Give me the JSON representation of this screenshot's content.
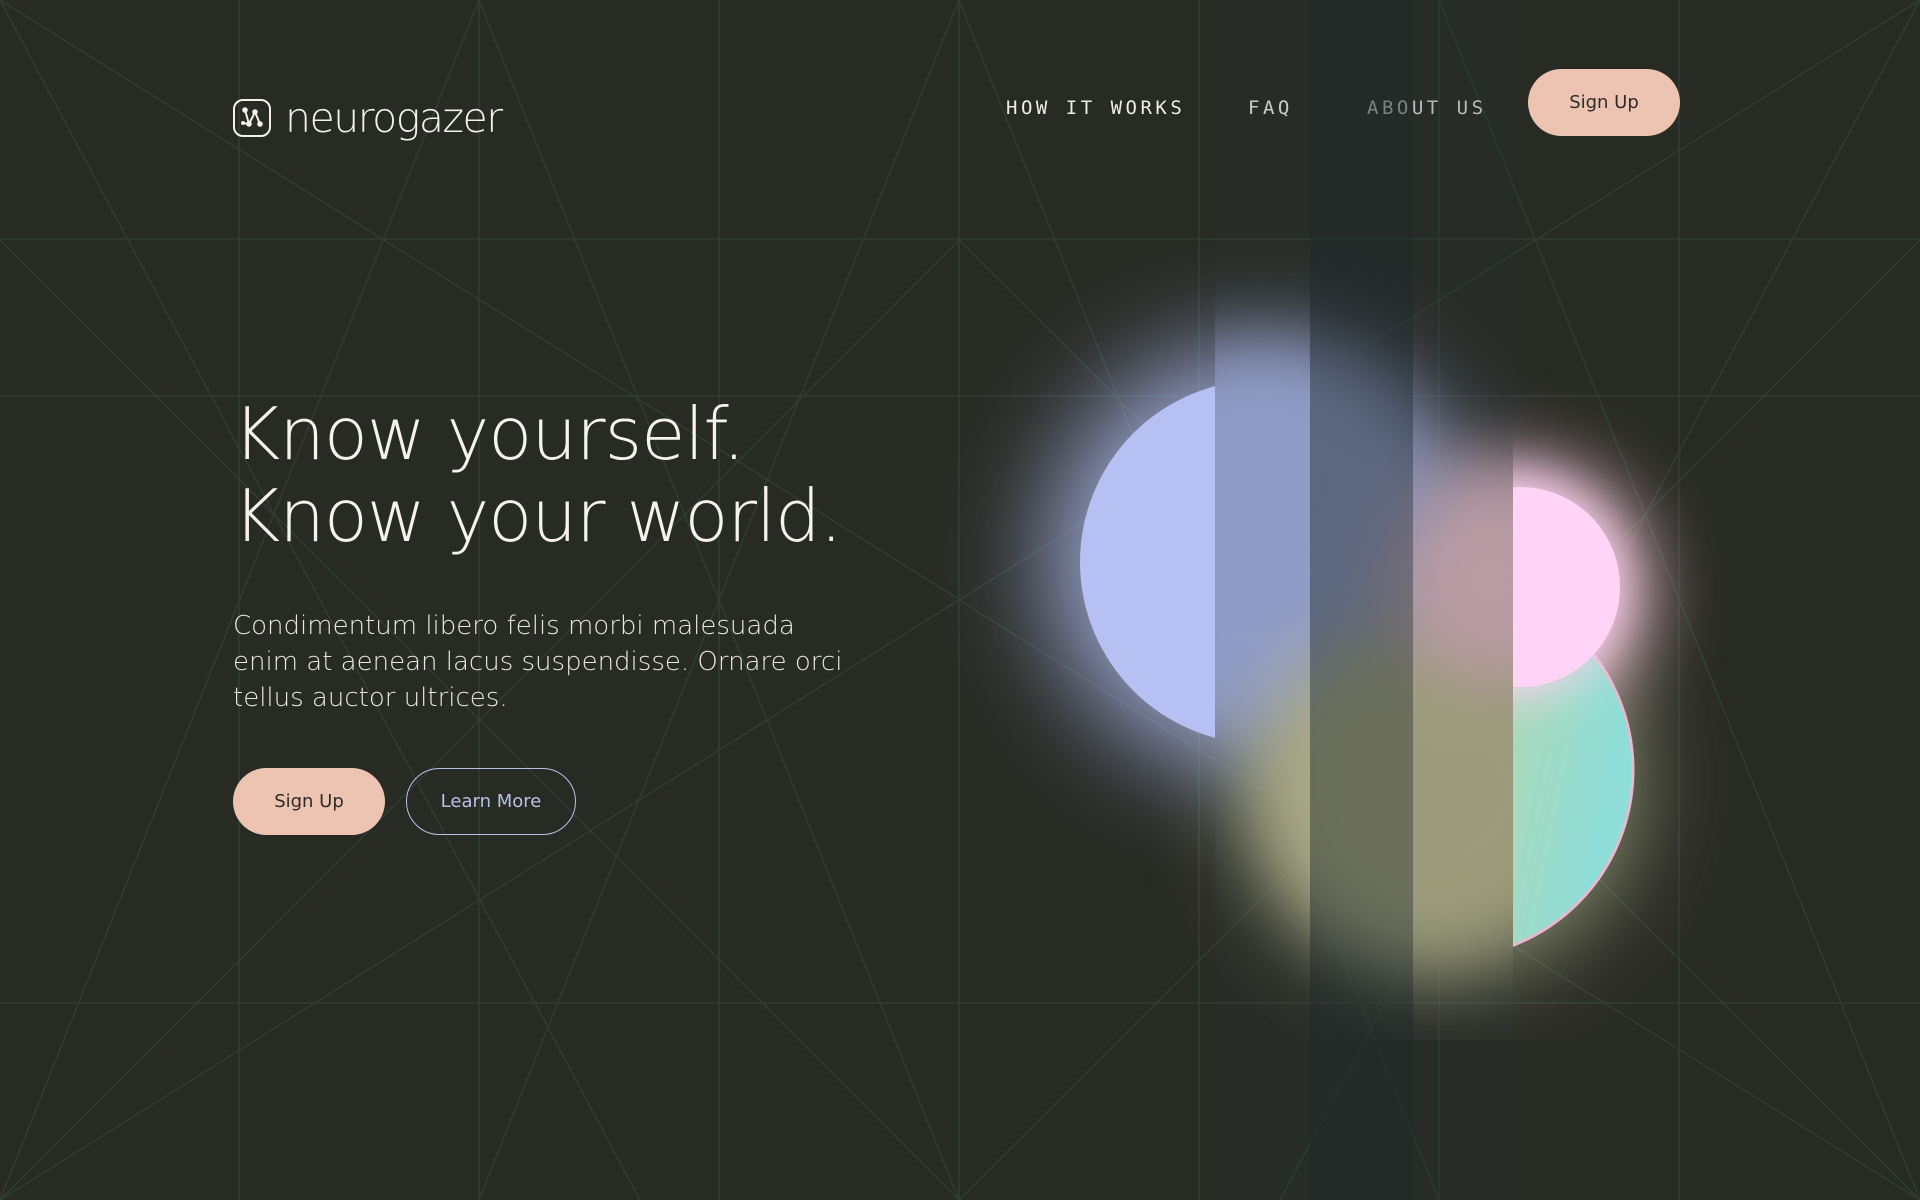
{
  "brand": {
    "name": "neurogazer",
    "logo_icon": "neural-nodes-icon"
  },
  "nav": {
    "items": [
      {
        "label": "HOW IT WORKS"
      },
      {
        "label": "FAQ"
      },
      {
        "label": "ABOUT US"
      }
    ],
    "signup_label": "Sign Up"
  },
  "hero": {
    "title_line1": "Know yourself.",
    "title_line2": "Know your world.",
    "body": "Condimentum libero felis morbi malesuada enim at aenean lacus suspendisse. Ornare orci tellus auctor ultrices.",
    "primary_label": "Sign Up",
    "secondary_label": "Learn More"
  },
  "colors": {
    "background": "#282a24",
    "accent_peach": "#edc4b1",
    "outline_lavender": "#b9c0e6",
    "text": "#f3f1ec",
    "grid_line": "#2f3f36"
  }
}
